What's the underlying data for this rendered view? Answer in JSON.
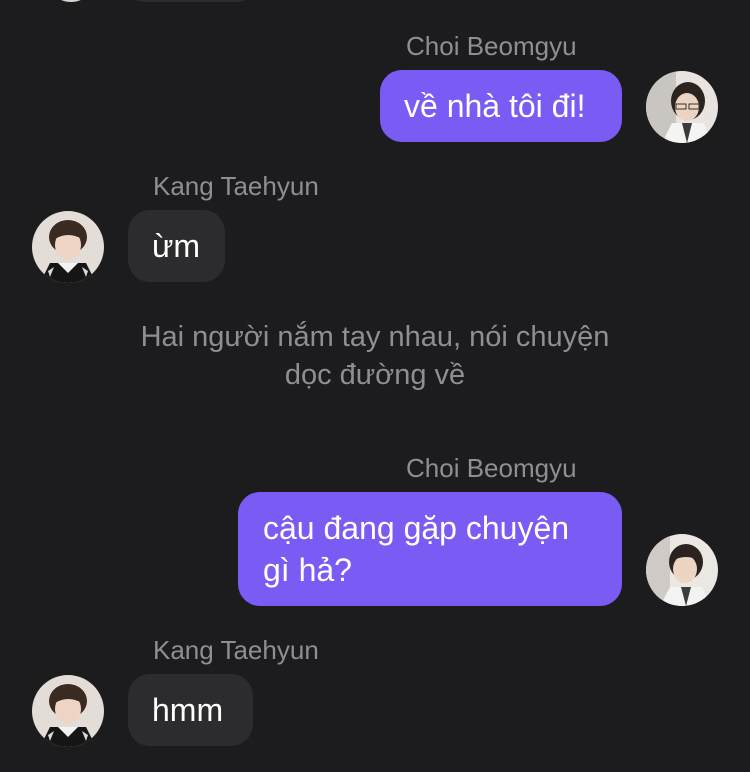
{
  "colors": {
    "background": "#1c1c1e",
    "outgoing_bubble": "#7a5cf5",
    "incoming_bubble": "#2c2c2e",
    "sender_name": "#8e8e93"
  },
  "participants": {
    "me": "Choi Beomgyu",
    "other": "Kang Taehyun"
  },
  "messages": [
    {
      "sender": "Choi Beomgyu",
      "direction": "outgoing",
      "text": "về nhà tôi đi!"
    },
    {
      "sender": "Kang Taehyun",
      "direction": "incoming",
      "text": "ừm"
    },
    {
      "sender": "Choi Beomgyu",
      "direction": "outgoing",
      "text": "cậu đang gặp chuyện gì hả?"
    },
    {
      "sender": "Kang Taehyun",
      "direction": "incoming",
      "text": "hmm"
    }
  ],
  "narration": {
    "line1": "Hai người nắm tay nhau, nói chuyện",
    "line2": "dọc đường về"
  },
  "icons": {
    "outgoing_avatar": "profile-photo-avatar",
    "incoming_avatar": "profile-photo-avatar"
  }
}
